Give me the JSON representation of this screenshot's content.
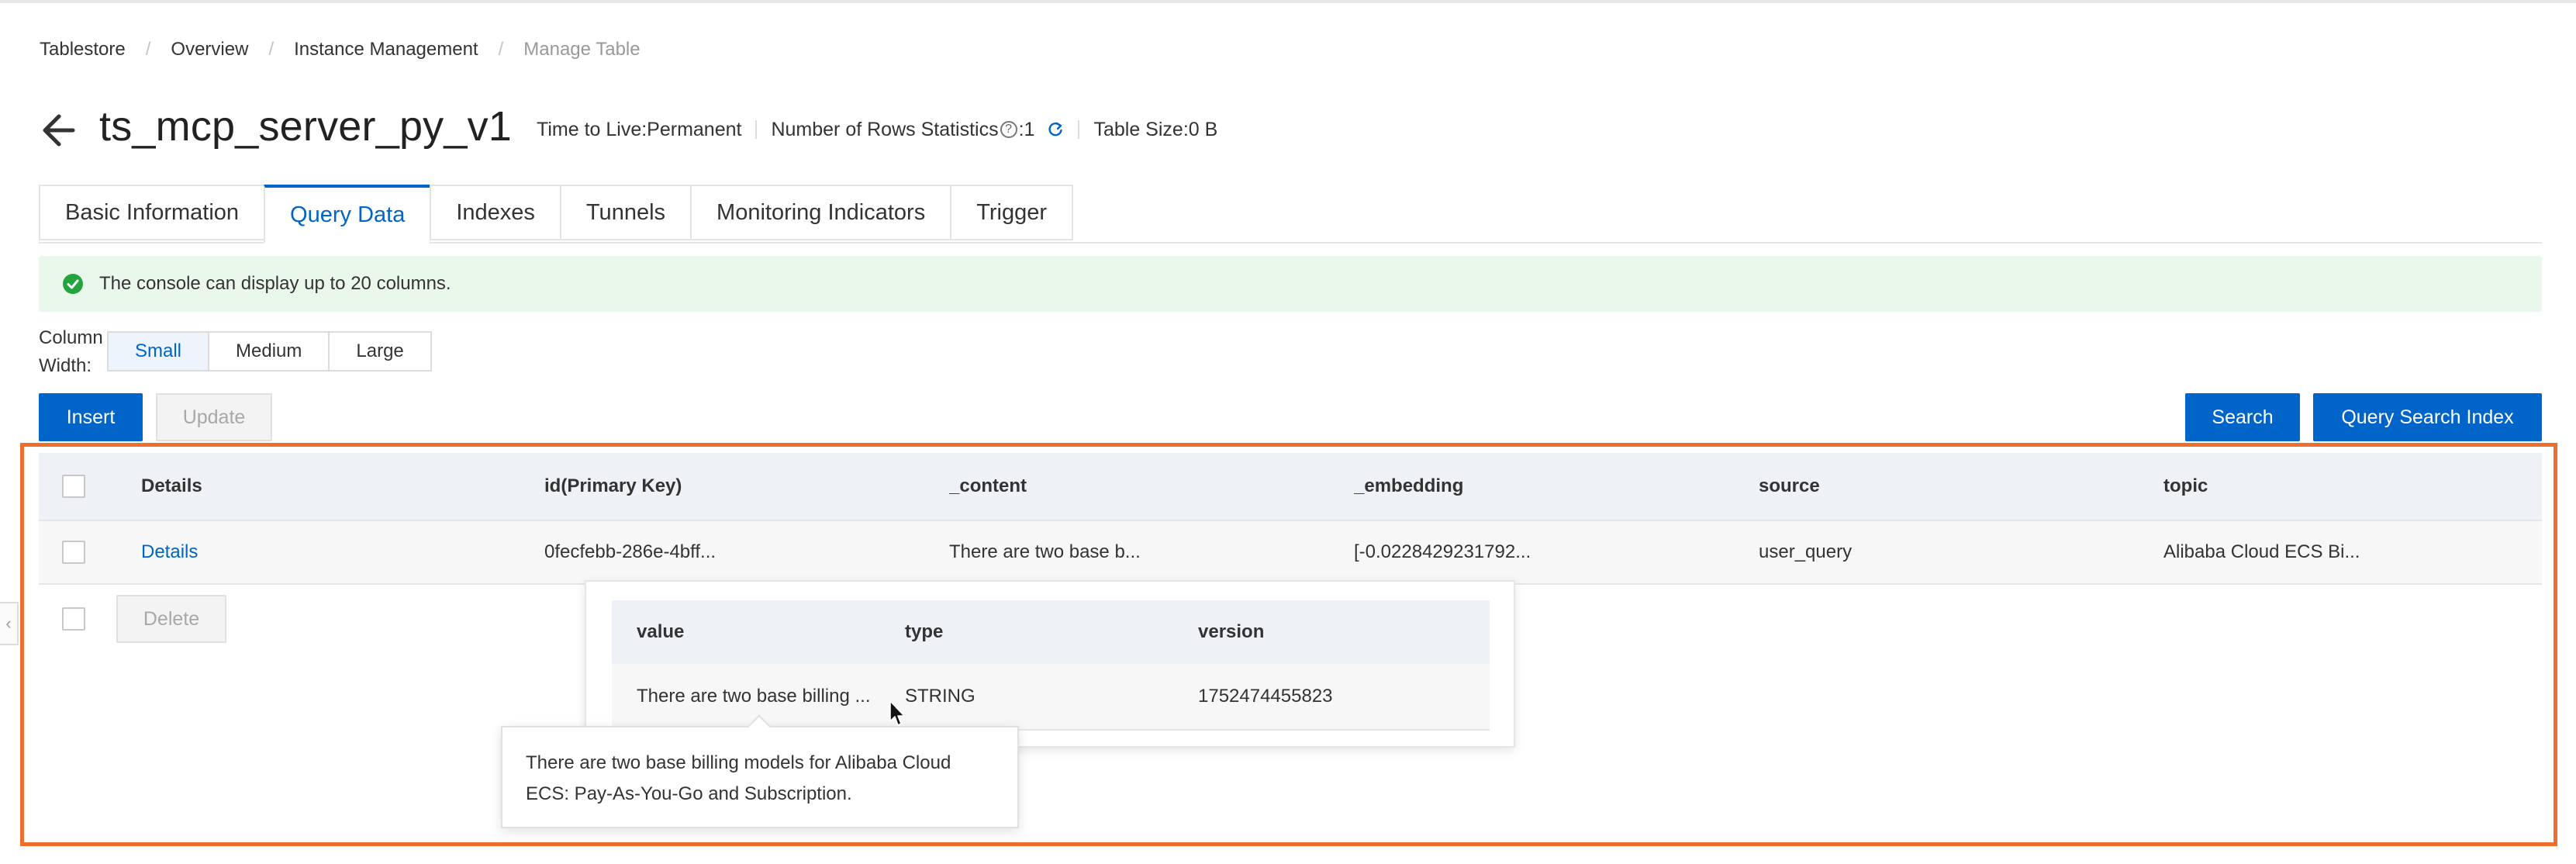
{
  "breadcrumb": [
    "Tablestore",
    "Overview",
    "Instance Management",
    "Manage Table"
  ],
  "header": {
    "title": "ts_mcp_server_py_v1",
    "ttl": "Time to Live:Permanent",
    "rows_label": "Number of Rows Statistics",
    "rows_value": ":1",
    "table_size": "Table Size:0 B"
  },
  "tabs": [
    "Basic Information",
    "Query Data",
    "Indexes",
    "Tunnels",
    "Monitoring Indicators",
    "Trigger"
  ],
  "active_tab": "Query Data",
  "notice": "The console can display up to 20 columns.",
  "column_width": {
    "label_line1": "Column",
    "label_line2": "Width:",
    "options": [
      "Small",
      "Medium",
      "Large"
    ],
    "selected": "Small"
  },
  "toolbar": {
    "insert": "Insert",
    "update": "Update",
    "search": "Search",
    "query_search_index": "Query Search Index"
  },
  "table": {
    "columns": [
      "Details",
      "id(Primary Key)",
      "_content",
      "_embedding",
      "source",
      "topic"
    ],
    "rows": [
      [
        "Details",
        "0fecfebb-286e-4bff...",
        "There are two base b...",
        "[-0.0228429231792...",
        "user_query",
        "Alibaba Cloud ECS Bi..."
      ]
    ]
  },
  "bulk": {
    "delete": "Delete"
  },
  "popover": {
    "columns": [
      "value",
      "type",
      "version"
    ],
    "row": [
      "There are two base billing ...",
      "STRING",
      "1752474455823"
    ]
  },
  "tooltip": {
    "line1": "There are two base billing models for Alibaba Cloud",
    "line2": "ECS: Pay-As-You-Go and Subscription."
  },
  "colors": {
    "primary": "#0064c8",
    "success": "#23a43f",
    "highlight": "#ee6e2d",
    "notice_bg": "#eaf8ec"
  },
  "icons": [
    "arrow-left-icon",
    "help-icon",
    "refresh-icon",
    "check-circle-icon",
    "cursor-icon",
    "chevron-left-icon"
  ]
}
